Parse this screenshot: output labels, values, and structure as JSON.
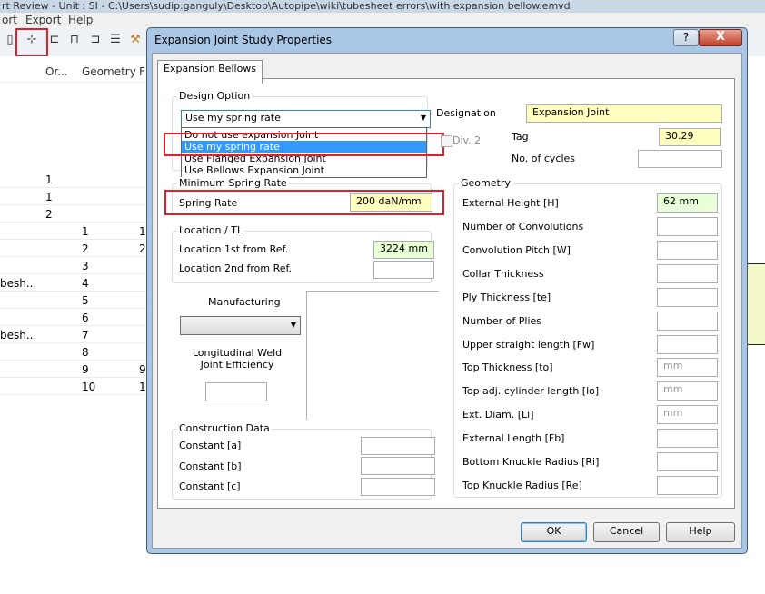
{
  "app": {
    "title": "rt Review  - Unit : SI - C:\\Users\\sudip.ganguly\\Desktop\\Autopipe\\wiki\\tubesheet errors\\with expansion bellow.emvd",
    "menu": [
      "ort",
      "Export",
      "Help"
    ]
  },
  "background_table": {
    "headers": [
      "Or...",
      "Geometry",
      "F"
    ],
    "rows": [
      {
        "a": "",
        "or": "1",
        "geo": "",
        "f": ""
      },
      {
        "a": "",
        "or": "1",
        "geo": "",
        "f": ""
      },
      {
        "a": "",
        "or": "2",
        "geo": "",
        "f": ""
      },
      {
        "a": "",
        "or": "",
        "geo": "1",
        "f": "1"
      },
      {
        "a": "",
        "or": "",
        "geo": "2",
        "f": "2"
      },
      {
        "a": "",
        "or": "",
        "geo": "3",
        "f": ""
      },
      {
        "a": "besh...",
        "or": "",
        "geo": "4",
        "f": ""
      },
      {
        "a": "",
        "or": "",
        "geo": "5",
        "f": ""
      },
      {
        "a": "",
        "or": "",
        "geo": "6",
        "f": ""
      },
      {
        "a": "besh...",
        "or": "",
        "geo": "7",
        "f": ""
      },
      {
        "a": "",
        "or": "",
        "geo": "8",
        "f": ""
      },
      {
        "a": "",
        "or": "",
        "geo": "9",
        "f": "9"
      },
      {
        "a": "",
        "or": "",
        "geo": "10",
        "f": "1"
      }
    ]
  },
  "dialog": {
    "title": "Expansion Joint Study Properties",
    "help_button": "?",
    "close_button": "X",
    "tab": "Expansion Bellows",
    "design_option": {
      "label": "Design Option",
      "selected": "Use my spring rate",
      "options": [
        "Do not use expansion Joint",
        "Use my spring rate",
        "Use Flanged Expansion Joint",
        "Use Bellows Expansion Joint"
      ]
    },
    "designation_label": "Designation",
    "designation_value": "Expansion Joint",
    "div2_label": "Div. 2",
    "tag_label": "Tag",
    "tag_value": "30.29",
    "cycles_label": "No. of cycles",
    "cycles_value": "",
    "min_spring": {
      "label": "Minimum Spring Rate",
      "spring_rate_label": "Spring Rate",
      "spring_rate_value": "200 daN/mm"
    },
    "location": {
      "label": "Location / TL",
      "first_label": "Location 1st from Ref.",
      "first_value": "3224 mm",
      "second_label": "Location 2nd from Ref.",
      "second_value": ""
    },
    "manufacturing": {
      "label": "Manufacturing",
      "weld_label": "Longitudinal Weld Joint Efficiency",
      "weld_value": ""
    },
    "construction": {
      "label": "Construction Data",
      "rows": [
        {
          "label": "Constant [a]",
          "value": ""
        },
        {
          "label": "Constant [b]",
          "value": ""
        },
        {
          "label": "Constant [c]",
          "value": ""
        }
      ]
    },
    "geometry": {
      "label": "Geometry",
      "rows": [
        {
          "label": "External Height [H]",
          "value": "62 mm",
          "placeholder": ""
        },
        {
          "label": "Number of Convolutions",
          "value": "",
          "placeholder": ""
        },
        {
          "label": "Convolution Pitch [W]",
          "value": "",
          "placeholder": ""
        },
        {
          "label": "Collar Thickness",
          "value": "",
          "placeholder": ""
        },
        {
          "label": "Ply Thickness [te]",
          "value": "",
          "placeholder": ""
        },
        {
          "label": "Number of Plies",
          "value": "",
          "placeholder": ""
        },
        {
          "label": "Upper straight length [Fw]",
          "value": "",
          "placeholder": ""
        },
        {
          "label": "Top Thickness [to]",
          "value": "",
          "placeholder": "mm"
        },
        {
          "label": "Top adj. cylinder length [lo]",
          "value": "",
          "placeholder": "mm"
        },
        {
          "label": "Ext. Diam. [Li]",
          "value": "",
          "placeholder": "mm"
        },
        {
          "label": "External Length [Fb]",
          "value": "",
          "placeholder": ""
        },
        {
          "label": "Bottom Knuckle Radius [Ri]",
          "value": "",
          "placeholder": ""
        },
        {
          "label": "Top Knuckle Radius [Re]",
          "value": "",
          "placeholder": ""
        }
      ]
    },
    "buttons": {
      "ok": "OK",
      "cancel": "Cancel",
      "help": "Help"
    },
    "colors": {
      "highlight_red": "#e0202a",
      "field_yellow": "#ffffc0",
      "field_green": "#e8ffd8",
      "selection_blue": "#3399ff"
    }
  }
}
